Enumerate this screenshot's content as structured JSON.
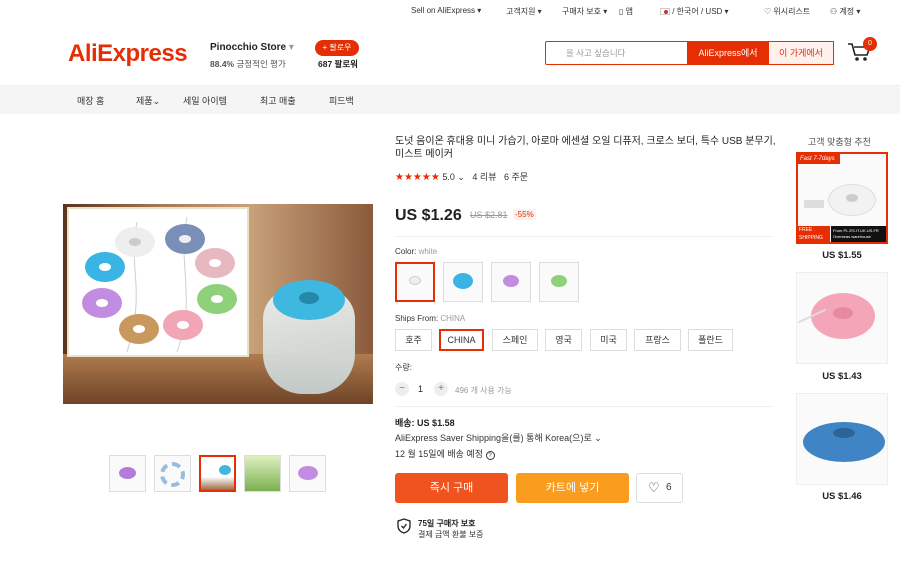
{
  "topbar": {
    "sell": "Sell on AliExpress",
    "support": "고객지원",
    "protection": "구매자 보호",
    "app": "앱",
    "locale": "/ 한국어 / USD",
    "wishlist": "위시리스트",
    "account": "계정"
  },
  "header": {
    "logo": "AliExpress",
    "store_name": "Pinocchio Store",
    "rating_pct": "88.4%",
    "rating_text": "긍정적인 평가",
    "follow": "+ 팔로우",
    "followers": "687 팔로워",
    "search_placeholder": "을 사고 싶습니다",
    "search_ae": "AliExpress에서",
    "search_store": "이 가게에서",
    "cart_count": "0"
  },
  "nav": [
    "매장 홈",
    "제품",
    "세일 아이템",
    "최고 매출",
    "피드백"
  ],
  "product": {
    "title": "도넛 음이온 휴대용 미니 가습기, 아로마 에센셜 오일 디퓨저, 크로스 보더, 특수 USB 분무기, 미스트 메이커",
    "rating": "5.0",
    "reviews": "4 리뷰",
    "orders": "6 주문",
    "price": "US $1.26",
    "old_price": "US $2.81",
    "discount": "-55%",
    "color_label": "Color:",
    "color_value": "white",
    "ships_label": "Ships From:",
    "ships_value": "CHINA",
    "ships_options": [
      "호주",
      "CHINA",
      "스페인",
      "영국",
      "미국",
      "프랑스",
      "폴란드"
    ],
    "qty_label": "수량:",
    "qty": "1",
    "stock": "496 개 사용 가능",
    "shipping_cost": "배송: US $1.58",
    "shipping_method": "AliExpress Saver Shipping을(를) 통해 Korea(으)로",
    "delivery": "12 월 15일에 배송 예정",
    "buy": "즉시 구매",
    "add_cart": "카트에 넣기",
    "wish_count": "6",
    "protect_title": "75일 구매자 보호",
    "protect_sub": "결제 금액 환불 보증"
  },
  "recommend": {
    "title": "고객 맞춤형 추천",
    "items": [
      {
        "price": "US $1.55",
        "tag": "Fast 7-7days",
        "free": "FREE SHIPPING",
        "from": "From PL.ES.IT.UK.US.FR Overseas warehouse"
      },
      {
        "price": "US $1.43"
      },
      {
        "price": "US $1.46"
      }
    ]
  }
}
